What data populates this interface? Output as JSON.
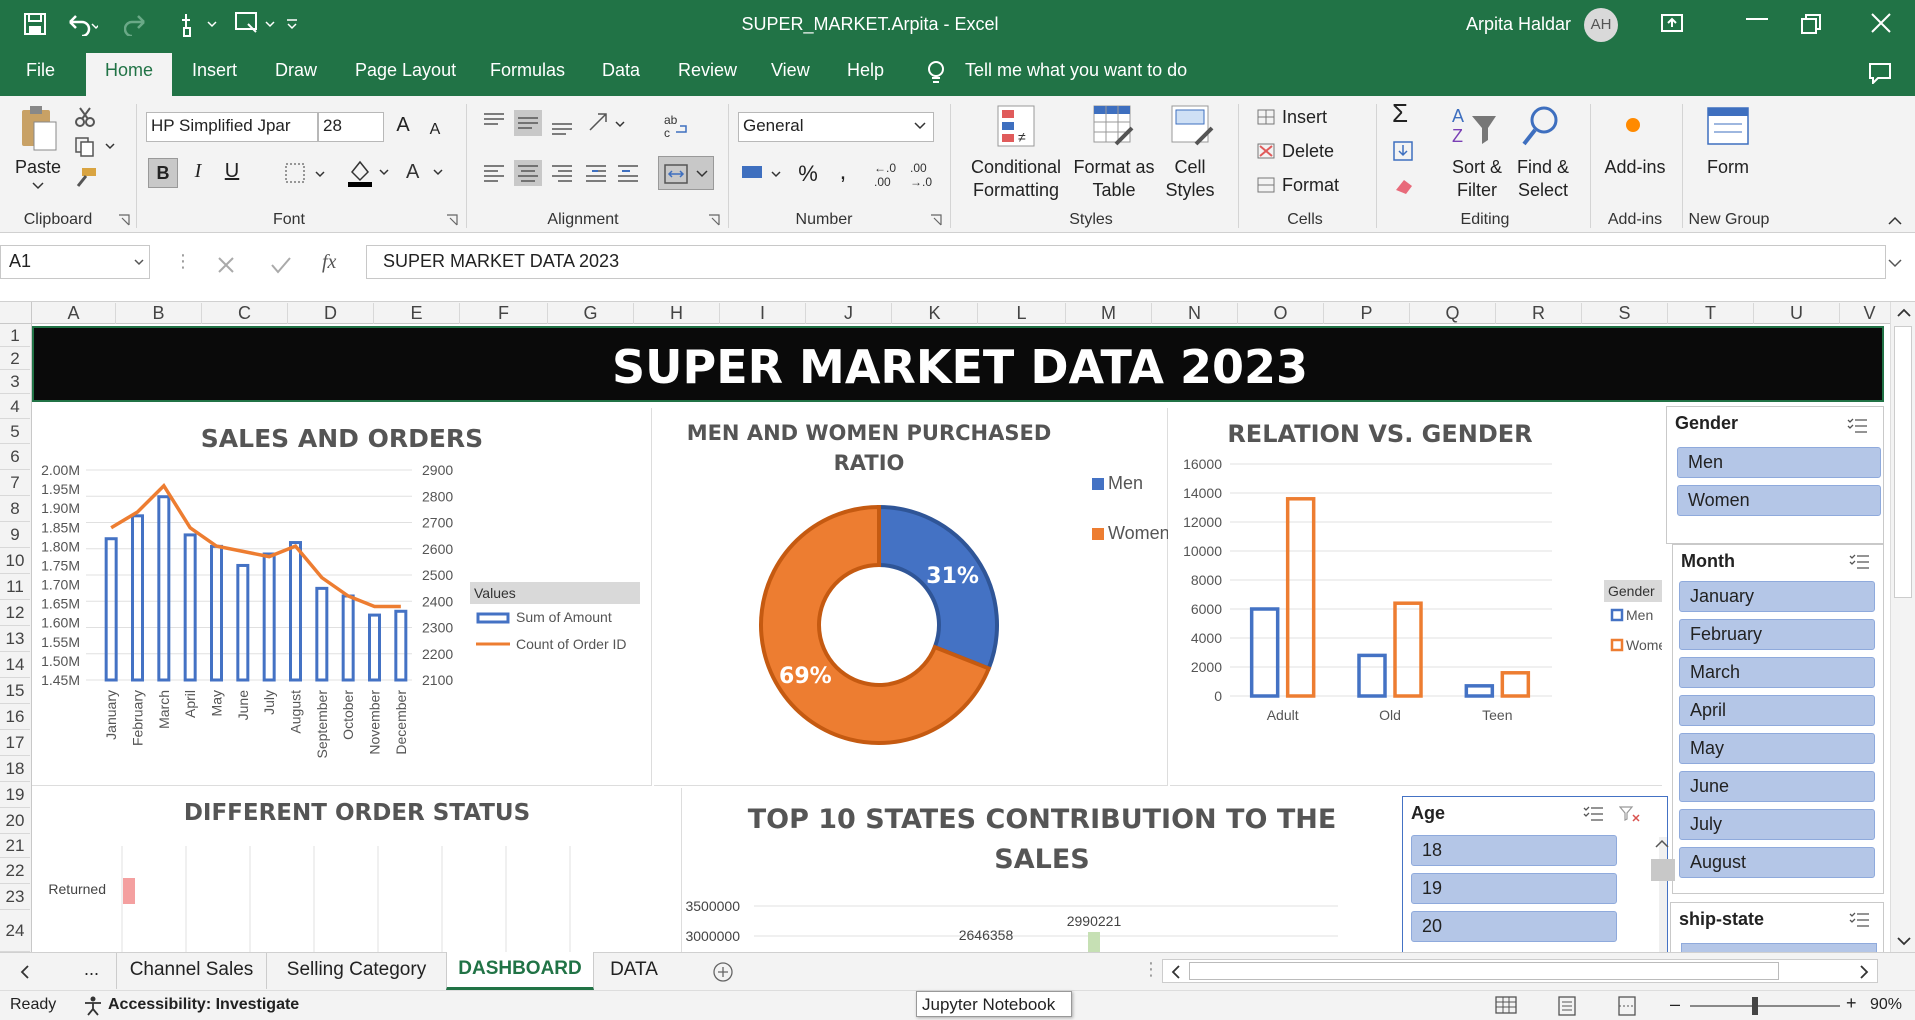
{
  "titlebar": {
    "doc_title": "SUPER_MARKET.Arpita  -  Excel",
    "user_name": "Arpita Haldar",
    "user_initials": "AH"
  },
  "tabs": [
    "File",
    "Home",
    "Insert",
    "Draw",
    "Page Layout",
    "Formulas",
    "Data",
    "Review",
    "View",
    "Help"
  ],
  "tell_me": "Tell me what you want to do",
  "ribbon": {
    "paste": "Paste",
    "font_name": "HP Simplified Jpar",
    "font_size": "28",
    "number_format": "General",
    "cond_fmt": [
      "Conditional",
      "Formatting"
    ],
    "format_table": [
      "Format as",
      "Table"
    ],
    "cell_styles": [
      "Cell",
      "Styles"
    ],
    "insert": "Insert",
    "delete": "Delete",
    "format": "Format",
    "sort_filter": [
      "Sort &",
      "Filter"
    ],
    "find_select": [
      "Find &",
      "Select"
    ],
    "addins": "Add-ins",
    "form": "Form",
    "groups": {
      "clipboard": "Clipboard",
      "font": "Font",
      "alignment": "Alignment",
      "number": "Number",
      "styles": "Styles",
      "cells": "Cells",
      "editing": "Editing",
      "addins": "Add-ins",
      "newgroup": "New Group"
    }
  },
  "formula_bar": {
    "name_box": "A1",
    "content": "SUPER MARKET DATA 2023"
  },
  "columns": [
    "A",
    "B",
    "C",
    "D",
    "E",
    "F",
    "G",
    "H",
    "I",
    "J",
    "K",
    "L",
    "M",
    "N",
    "O",
    "P",
    "Q",
    "R",
    "S",
    "T",
    "U",
    "V"
  ],
  "rows": [
    "1",
    "2",
    "3",
    "4",
    "5",
    "6",
    "7",
    "8",
    "9",
    "10",
    "11",
    "12",
    "13",
    "14",
    "15",
    "16",
    "17",
    "18",
    "19",
    "20",
    "21",
    "22",
    "23",
    "24"
  ],
  "dashboard": {
    "banner": "SUPER MARKET DATA 2023",
    "sales_title": "SALES AND ORDERS",
    "ratio_title": [
      "MEN AND WOMEN PURCHASED",
      "RATIO"
    ],
    "relation_title": "RELATION VS. GENDER",
    "status_title": "DIFFERENT ORDER STATUS",
    "states_title": [
      "TOP 10 STATES CONTRIBUTION TO THE",
      "SALES"
    ]
  },
  "chart_data": [
    {
      "type": "bar",
      "title": "SALES AND ORDERS",
      "categories": [
        "January",
        "February",
        "March",
        "April",
        "May",
        "June",
        "July",
        "August",
        "September",
        "October",
        "November",
        "December"
      ],
      "series": [
        {
          "name": "Sum of Amount",
          "values": [
            1820000,
            1880000,
            1930000,
            1830000,
            1800000,
            1750000,
            1780000,
            1810000,
            1690000,
            1670000,
            1620000,
            1630000
          ],
          "axis": "left",
          "type": "bar"
        },
        {
          "name": "Count of Order ID",
          "values": [
            2680,
            2740,
            2840,
            2680,
            2610,
            2590,
            2570,
            2610,
            2490,
            2420,
            2380,
            2380
          ],
          "axis": "right",
          "type": "line"
        }
      ],
      "ylim": [
        1450000,
        2000000
      ],
      "ylim_right": [
        2100,
        2900
      ],
      "y_ticks_left": [
        "2.00M",
        "1.95M",
        "1.90M",
        "1.85M",
        "1.80M",
        "1.75M",
        "1.70M",
        "1.65M",
        "1.60M",
        "1.55M",
        "1.50M",
        "1.45M"
      ],
      "y_ticks_right": [
        "2900",
        "2800",
        "2700",
        "2600",
        "2500",
        "2400",
        "2300",
        "2200",
        "2100"
      ],
      "legend_title": "Values",
      "legend": "right"
    },
    {
      "type": "pie",
      "title": "MEN AND WOMEN PURCHASED RATIO",
      "categories": [
        "Men",
        "Women"
      ],
      "values": [
        31,
        69
      ],
      "labels": [
        "31%",
        "69%"
      ],
      "donut": true,
      "legend": "right"
    },
    {
      "type": "bar",
      "title": "RELATION VS. GENDER",
      "categories": [
        "Adult",
        "Old",
        "Teen"
      ],
      "series": [
        {
          "name": "Men",
          "values": [
            6000,
            2800,
            700
          ]
        },
        {
          "name": "Women",
          "values": [
            13600,
            6400,
            1600
          ]
        }
      ],
      "ylim": [
        0,
        16000
      ],
      "y_ticks": [
        "16000",
        "14000",
        "12000",
        "10000",
        "8000",
        "6000",
        "4000",
        "2000",
        "0"
      ],
      "legend_title": "Gender",
      "legend": "right"
    },
    {
      "type": "bar",
      "title": "DIFFERENT ORDER STATUS",
      "categories": [
        "Returned"
      ],
      "values": [
        1
      ]
    },
    {
      "type": "bar",
      "title": "TOP 10 STATES CONTRIBUTION TO THE SALES",
      "y_ticks": [
        "3500000",
        "3000000"
      ],
      "data_labels": [
        "2990221",
        "2646358"
      ],
      "values": [
        2990221,
        2646358
      ]
    }
  ],
  "slicers": {
    "gender": {
      "title": "Gender",
      "items": [
        "Men",
        "Women"
      ]
    },
    "month": {
      "title": "Month",
      "items": [
        "January",
        "February",
        "March",
        "April",
        "May",
        "June",
        "July",
        "August"
      ]
    },
    "age": {
      "title": "Age",
      "items": [
        "18",
        "19",
        "20"
      ]
    },
    "ship_state": {
      "title": "ship-state"
    }
  },
  "sheet_tabs": [
    "...",
    "Channel Sales",
    "Selling Category",
    "DASHBOARD",
    "DATA"
  ],
  "status": {
    "ready": "Ready",
    "accessibility": "Accessibility: Investigate",
    "tooltip": "Jupyter Notebook",
    "zoom": "90%"
  },
  "colors": {
    "excel_green": "#217346",
    "men": "#4472c4",
    "women": "#ed7d31",
    "slicer_item": "#b4c6e7"
  }
}
